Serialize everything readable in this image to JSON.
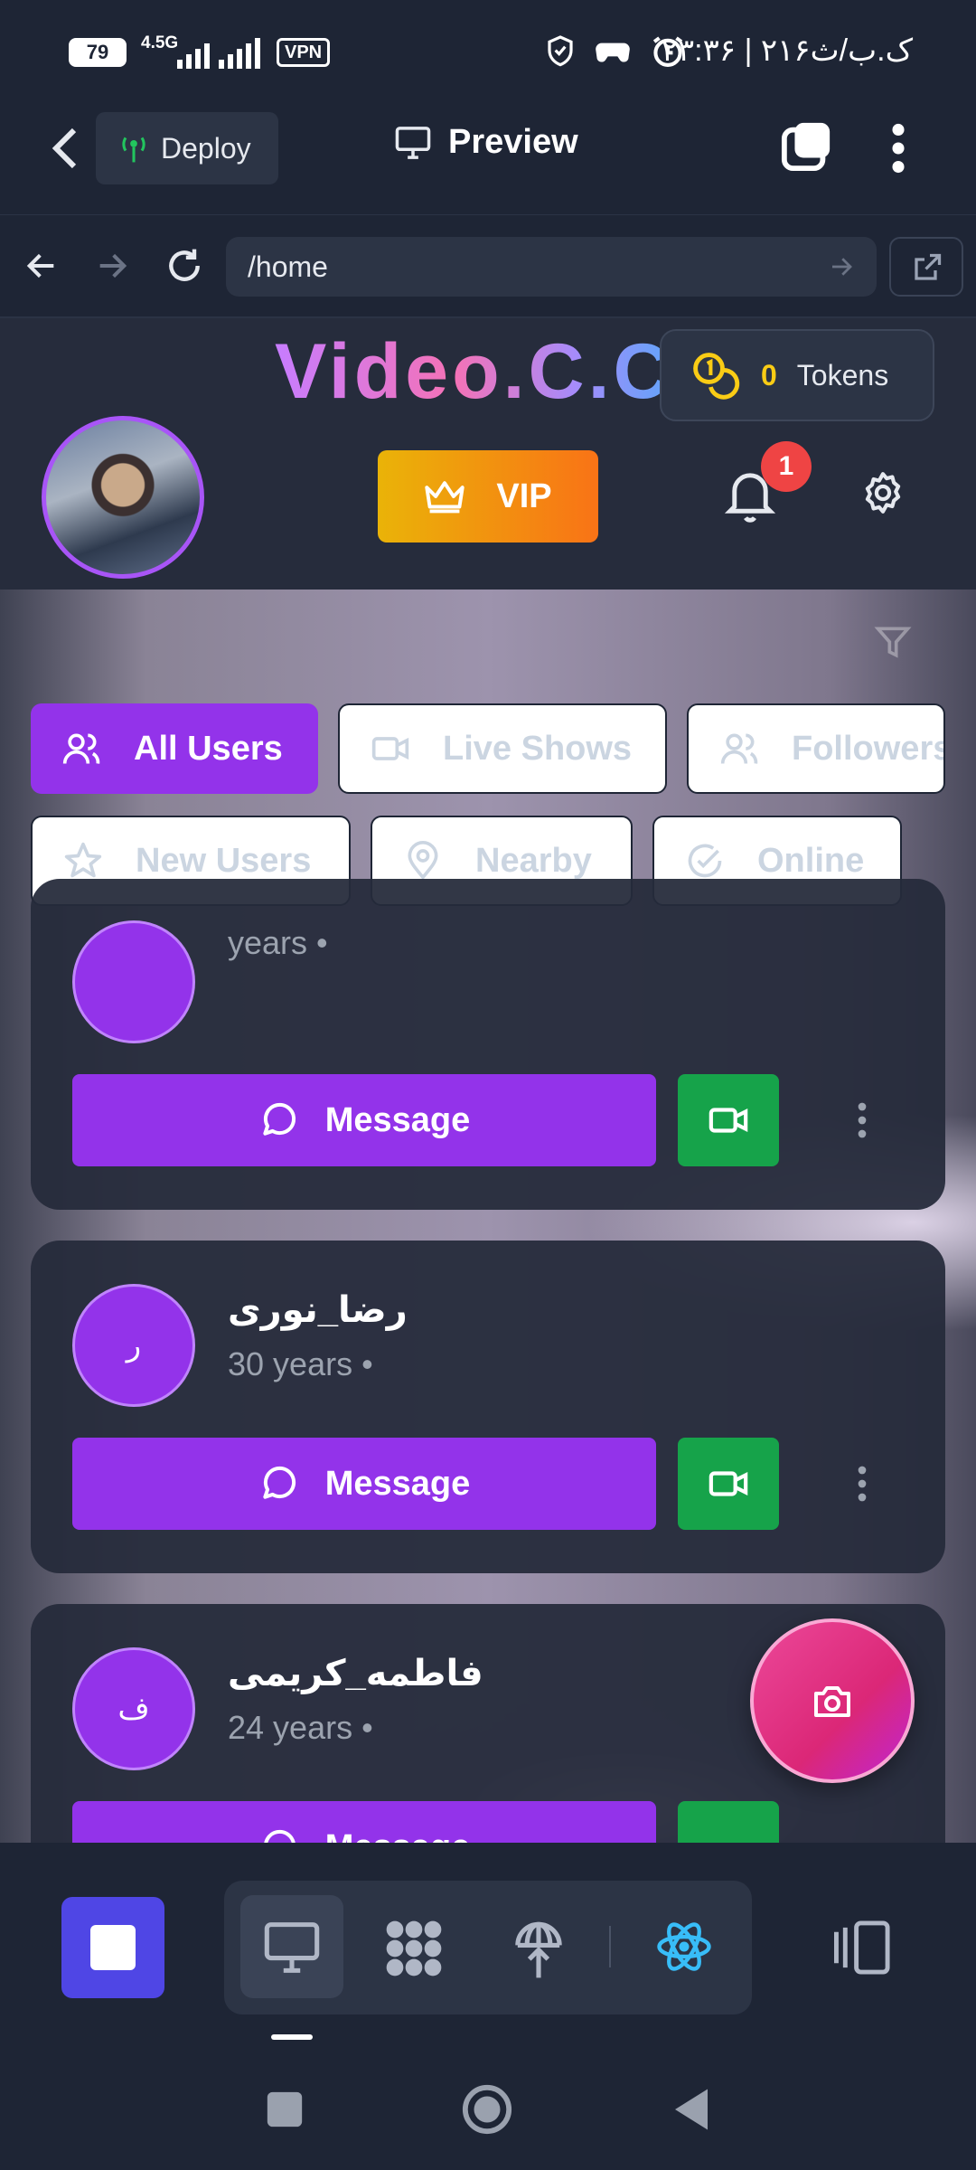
{
  "status_bar": {
    "battery": "79",
    "network": "4.5G",
    "vpn": "VPN",
    "clock_date": "۲۳:۳۶ | ۲۱۶ک.ب/ث"
  },
  "header": {
    "deploy_label": "Deploy",
    "preview_label": "Preview"
  },
  "url_bar": {
    "path": "/home"
  },
  "app": {
    "brand": "Video.C.C",
    "tokens_count": "0",
    "tokens_label": "Tokens",
    "vip_label": "VIP",
    "notification_count": "1"
  },
  "filters": [
    {
      "label": "All Users",
      "icon": "users-icon",
      "active": true
    },
    {
      "label": "Live Shows",
      "icon": "video-icon",
      "active": false
    },
    {
      "label": "Followers",
      "icon": "users-icon",
      "active": false
    },
    {
      "label": "New Users",
      "icon": "star-icon",
      "active": false
    },
    {
      "label": "Nearby",
      "icon": "map-pin-icon",
      "active": false
    },
    {
      "label": "Online",
      "icon": "check-circle-icon",
      "active": false
    }
  ],
  "users": [
    {
      "initial": "",
      "name": "",
      "age": "years •"
    },
    {
      "initial": "ر",
      "name": "رضا_نوری",
      "age": "30 years •"
    },
    {
      "initial": "ف",
      "name": "فاطمه_کریمی",
      "age": "24 years •"
    }
  ],
  "card_actions": {
    "message_label": "Message"
  },
  "colors": {
    "accent": "#9333ea",
    "video_button": "#16a34a",
    "fab": "#ec4899",
    "badge": "#ef4444",
    "token": "#facc15"
  }
}
